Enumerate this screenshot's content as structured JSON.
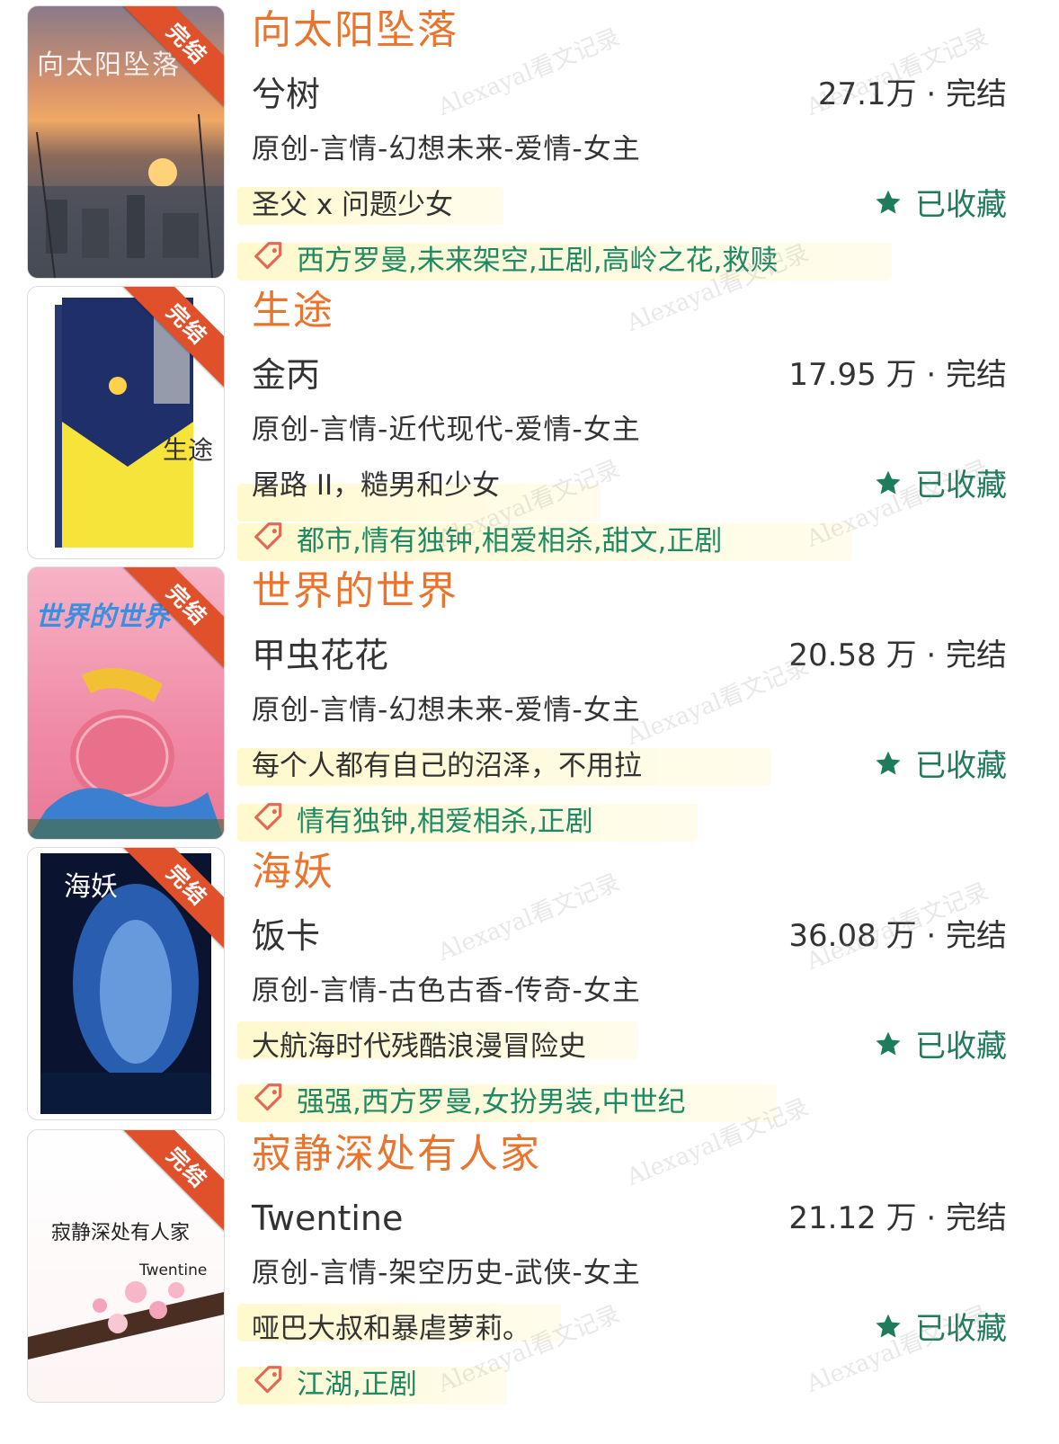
{
  "accent_colors": {
    "title": "#e8742d",
    "tag": "#1e8a63",
    "favorite": "#1e7c5c",
    "ribbon": "#e0502b"
  },
  "watermark_text": "Alexayal看文记录",
  "books": [
    {
      "ribbon": "完结",
      "title": "向太阳坠落",
      "author": "兮树",
      "stats": "27.1万 · 完结",
      "genre": "原创-言情-幻想未来-爱情-女主",
      "intro": "圣父 x 问题少女",
      "favorite_label": "已收藏",
      "tags": "西方罗曼,未来架空,正剧,高岭之花,救赎",
      "cover_title": "向太阳坠落"
    },
    {
      "ribbon": "完结",
      "title": "生途",
      "author": "金丙",
      "stats": "17.95 万 · 完结",
      "genre": "原创-言情-近代现代-爱情-女主",
      "intro": "屠路 II，糙男和少女",
      "favorite_label": "已收藏",
      "tags": "都市,情有独钟,相爱相杀,甜文,正剧",
      "cover_title": "生途"
    },
    {
      "ribbon": "完结",
      "title": "世界的世界",
      "author": "甲虫花花",
      "stats": "20.58 万 · 完结",
      "genre": "原创-言情-幻想未来-爱情-女主",
      "intro": "每个人都有自己的沼泽，不用拉",
      "favorite_label": "已收藏",
      "tags": "情有独钟,相爱相杀,正剧",
      "cover_title": "世界的世界"
    },
    {
      "ribbon": "完结",
      "title": "海妖",
      "author": "饭卡",
      "stats": "36.08 万 · 完结",
      "genre": "原创-言情-古色古香-传奇-女主",
      "intro": "大航海时代残酷浪漫冒险史",
      "favorite_label": "已收藏",
      "tags": "强强,西方罗曼,女扮男装,中世纪",
      "cover_title": "海妖"
    },
    {
      "ribbon": "完结",
      "title": "寂静深处有人家",
      "author": "Twentine",
      "stats": "21.12 万 · 完结",
      "genre": "原创-言情-架空历史-武侠-女主",
      "intro": "哑巴大叔和暴虐萝莉。",
      "favorite_label": "已收藏",
      "tags": "江湖,正剧",
      "cover_title": "寂静深处有人家",
      "cover_author": "Twentine"
    }
  ]
}
